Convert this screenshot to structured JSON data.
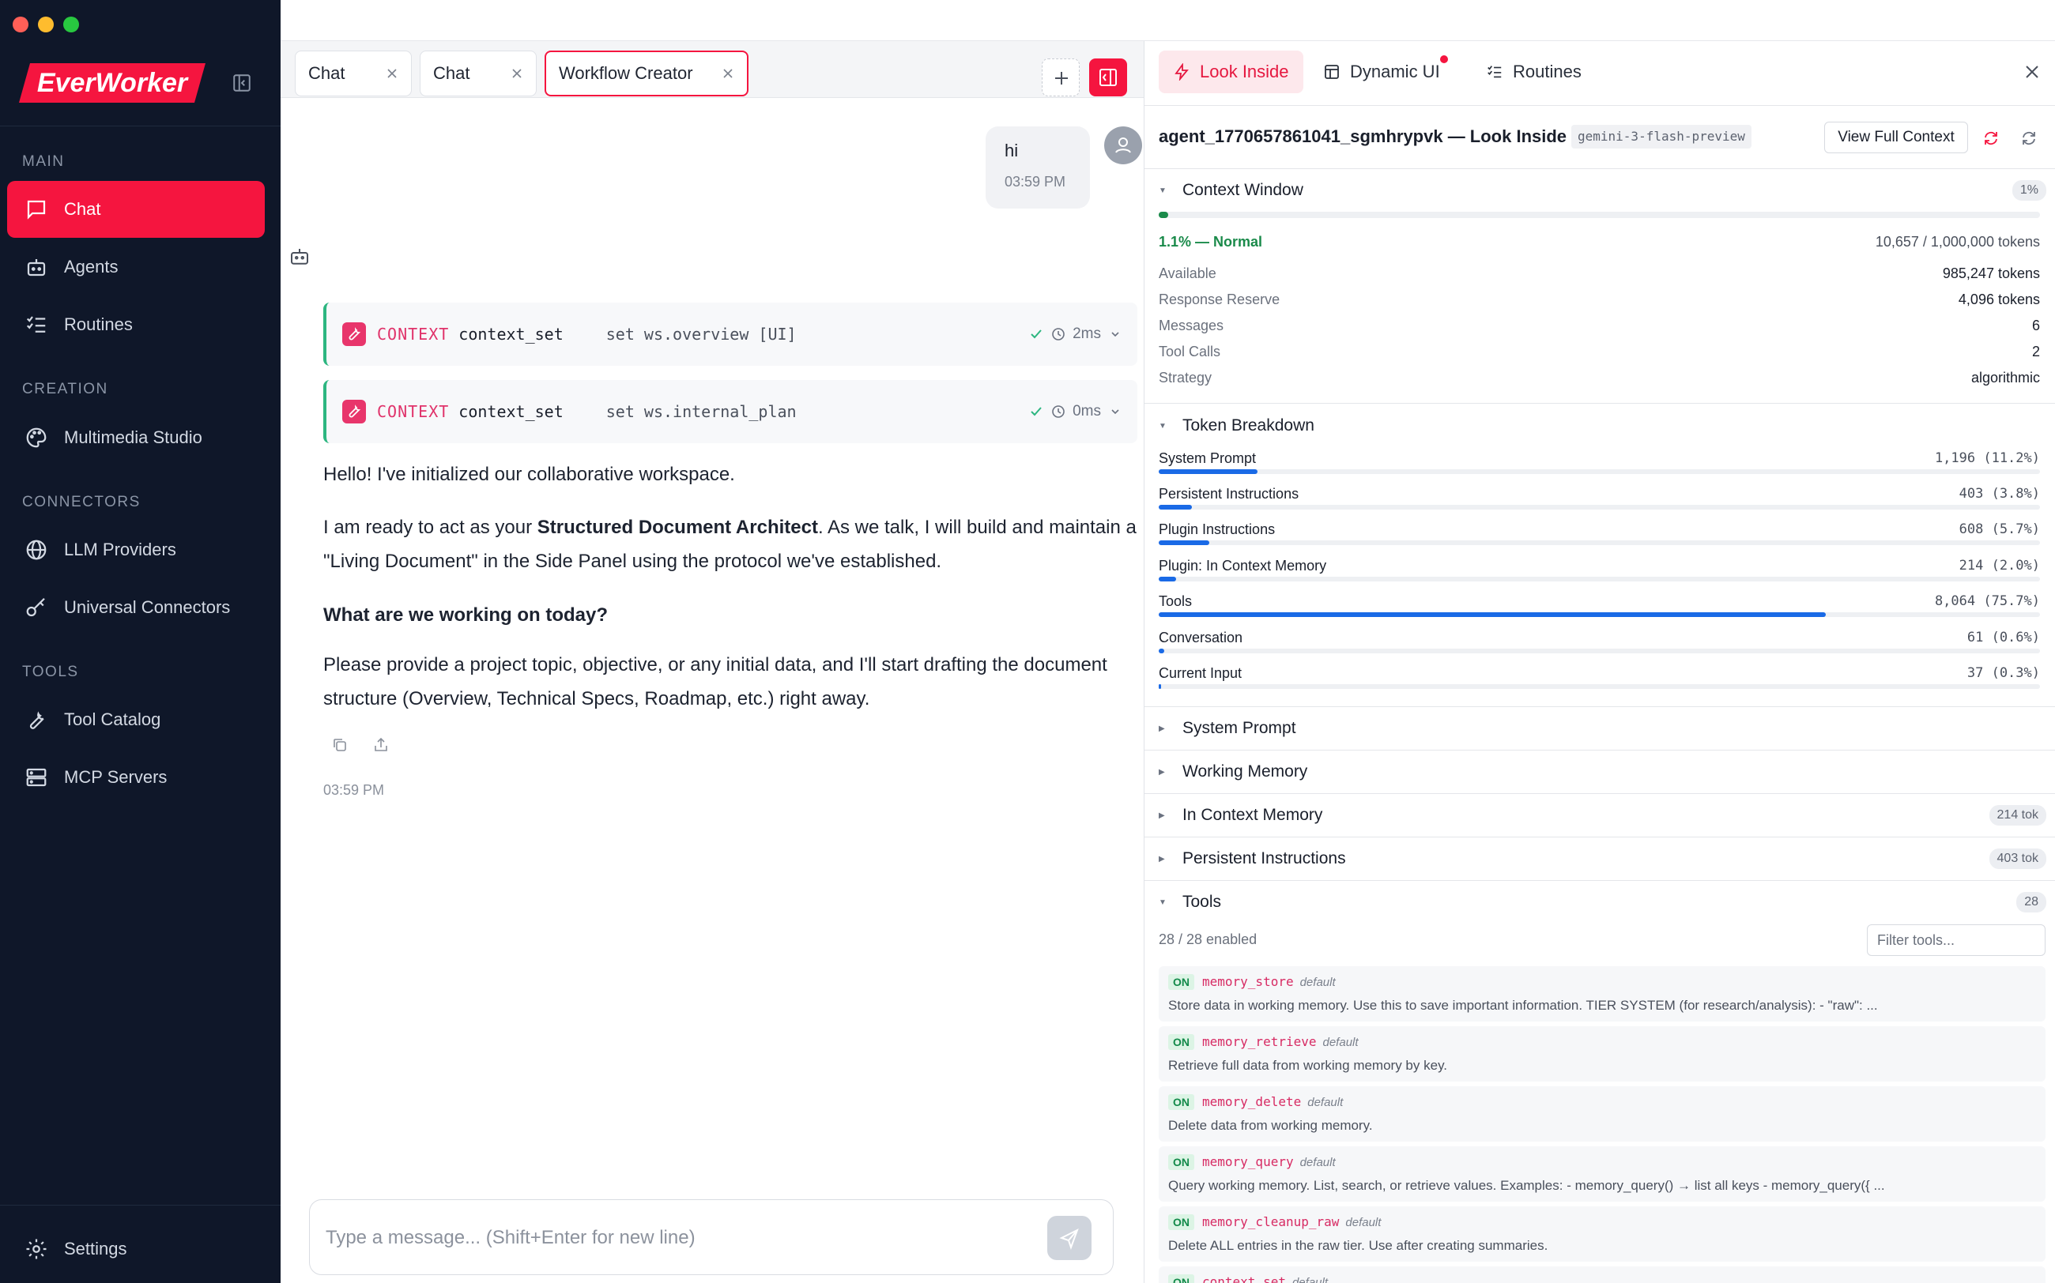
{
  "app": {
    "brand": "EverWorker",
    "brand_color": "#f5153f"
  },
  "sidebar": {
    "sections": {
      "main": "MAIN",
      "creation": "CREATION",
      "connectors": "CONNECTORS",
      "tools": "TOOLS"
    },
    "items": [
      {
        "label": "Chat",
        "icon": "chat-icon",
        "active": true
      },
      {
        "label": "Agents",
        "icon": "robot-icon"
      },
      {
        "label": "Routines",
        "icon": "checklist-icon"
      },
      {
        "label": "Multimedia Studio",
        "icon": "palette-icon"
      },
      {
        "label": "LLM Providers",
        "icon": "globe-icon"
      },
      {
        "label": "Universal Connectors",
        "icon": "key-icon"
      },
      {
        "label": "Tool Catalog",
        "icon": "wrench-icon"
      },
      {
        "label": "MCP Servers",
        "icon": "server-icon"
      }
    ],
    "settings": "Settings"
  },
  "tabs": [
    {
      "label": "Chat"
    },
    {
      "label": "Chat"
    },
    {
      "label": "Workflow Creator",
      "active": true
    }
  ],
  "chat": {
    "user_message": {
      "text": "hi",
      "time": "03:59 PM"
    },
    "tool_calls": [
      {
        "label": "CONTEXT",
        "name": "context_set",
        "args": "set ws.overview [UI]",
        "duration": "2ms"
      },
      {
        "label": "CONTEXT",
        "name": "context_set",
        "args": "set ws.internal_plan",
        "duration": "0ms"
      }
    ],
    "reply": {
      "p1": "Hello! I've initialized our collaborative workspace.",
      "p2_pre": "I am ready to act as your ",
      "p2_bold": "Structured Document Architect",
      "p2_post": ". As we talk, I will build and maintain a \"Living Document\" in the Side Panel using the protocol we've established.",
      "p3": "What are we working on today?",
      "p4": "Please provide a project topic, objective, or any initial data, and I'll start drafting the document structure (Overview, Technical Specs, Roadmap, etc.) right away.",
      "time": "03:59 PM"
    },
    "composer_placeholder": "Type a message... (Shift+Enter for new line)"
  },
  "panel": {
    "tabs": [
      {
        "label": "Look Inside",
        "icon": "bolt-icon",
        "active": true
      },
      {
        "label": "Dynamic UI",
        "icon": "layout-icon",
        "notify": true
      },
      {
        "label": "Routines",
        "icon": "checklist-icon"
      }
    ],
    "header": {
      "title": "agent_1770657861041_sgmhrypvk — Look Inside",
      "model": "gemini-3-flash-preview",
      "view_full_context": "View Full Context"
    },
    "context_window": {
      "title": "Context Window",
      "badge": "1%",
      "usage_percent": 1.1,
      "status": "1.1% — Normal",
      "status_color": "#1a8a4a",
      "tokens": "10,657 / 1,000,000 tokens",
      "rows": [
        {
          "k": "Available",
          "v": "985,247 tokens"
        },
        {
          "k": "Response Reserve",
          "v": "4,096 tokens"
        },
        {
          "k": "Messages",
          "v": "6"
        },
        {
          "k": "Tool Calls",
          "v": "2"
        },
        {
          "k": "Strategy",
          "v": "algorithmic"
        }
      ]
    },
    "token_breakdown": {
      "title": "Token Breakdown",
      "items": [
        {
          "k": "System Prompt",
          "v": "1,196 (11.2%)",
          "pct": 11.2
        },
        {
          "k": "Persistent Instructions",
          "v": "403 (3.8%)",
          "pct": 3.8
        },
        {
          "k": "Plugin Instructions",
          "v": "608 (5.7%)",
          "pct": 5.7
        },
        {
          "k": "Plugin: In Context Memory",
          "v": "214 (2.0%)",
          "pct": 2.0
        },
        {
          "k": "Tools",
          "v": "8,064 (75.7%)",
          "pct": 75.7
        },
        {
          "k": "Conversation",
          "v": "61 (0.6%)",
          "pct": 0.6
        },
        {
          "k": "Current Input",
          "v": "37 (0.3%)",
          "pct": 0.3
        }
      ]
    },
    "sections": [
      {
        "title": "System Prompt"
      },
      {
        "title": "Working Memory"
      },
      {
        "title": "In Context Memory",
        "badge": "214 tok"
      },
      {
        "title": "Persistent Instructions",
        "badge": "403 tok"
      }
    ],
    "tools": {
      "title": "Tools",
      "badge": "28",
      "enabled": "28 / 28 enabled",
      "filter_placeholder": "Filter tools...",
      "on_label": "ON",
      "default_label": "default",
      "items": [
        {
          "name": "memory_store",
          "desc": "Store data in working memory. Use this to save important information. TIER SYSTEM (for research/analysis): - \"raw\": ..."
        },
        {
          "name": "memory_retrieve",
          "desc": "Retrieve full data from working memory by key."
        },
        {
          "name": "memory_delete",
          "desc": "Delete data from working memory."
        },
        {
          "name": "memory_query",
          "desc": "Query working memory. List, search, or retrieve values. Examples: - memory_query() → list all keys - memory_query({ ..."
        },
        {
          "name": "memory_cleanup_raw",
          "desc": "Delete ALL entries in the raw tier. Use after creating summaries."
        },
        {
          "name": "context_set",
          "desc": ""
        }
      ]
    }
  }
}
